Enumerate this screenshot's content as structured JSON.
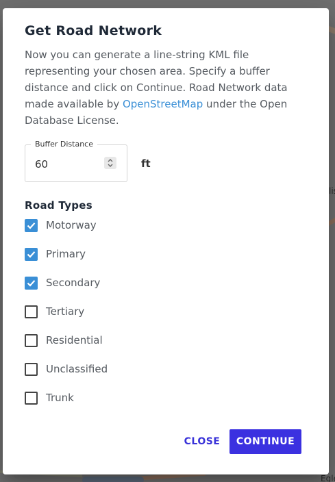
{
  "dialog": {
    "title": "Get Road Network",
    "description_before_link": "Now you can generate a line-string KML file representing your chosen area. Specify a buffer distance and click on Continue. Road Network data made available by ",
    "link_text": "OpenStreetMap",
    "description_after_link": " under the Open Database License.",
    "buffer": {
      "label": "Buffer Distance",
      "value": "60",
      "unit": "ft"
    },
    "road_types": {
      "heading": "Road Types",
      "items": [
        {
          "label": "Motorway",
          "checked": true
        },
        {
          "label": "Primary",
          "checked": true
        },
        {
          "label": "Secondary",
          "checked": true
        },
        {
          "label": "Tertiary",
          "checked": false
        },
        {
          "label": "Residential",
          "checked": false
        },
        {
          "label": "Unclassified",
          "checked": false
        },
        {
          "label": "Trunk",
          "checked": false
        }
      ]
    },
    "close_label": "CLOSE",
    "continue_label": "CONTINUE"
  },
  "map": {
    "labels": [
      "lis",
      "Egle"
    ]
  },
  "colors": {
    "accent": "#3a8fd6",
    "primary_button": "#3b31e0",
    "title": "#1f2937",
    "body_text": "#555a60"
  }
}
